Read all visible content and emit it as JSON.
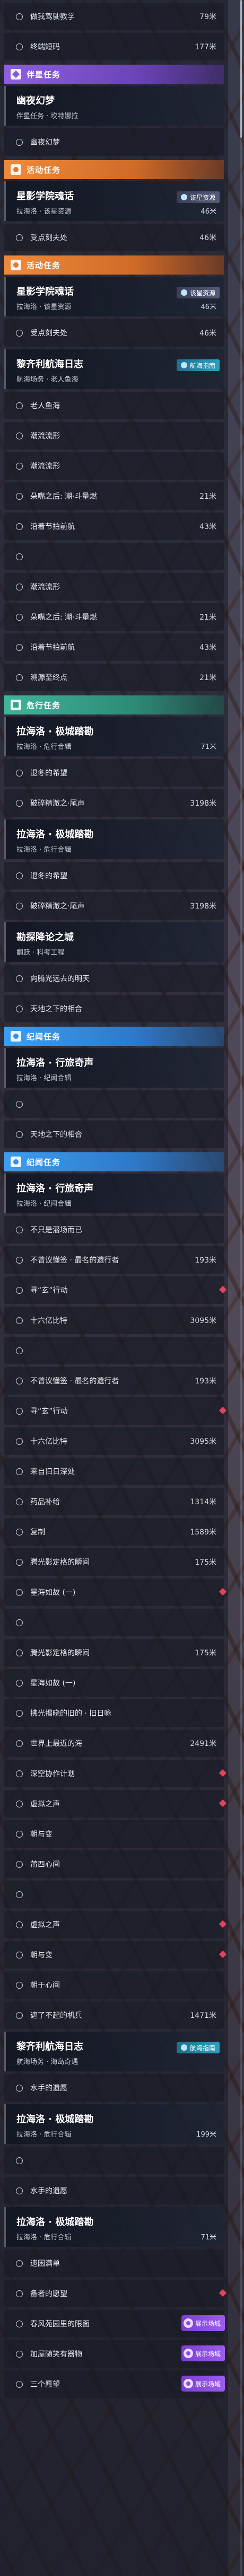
{
  "items": [
    {
      "t": "row",
      "label": "做我驾驶教学",
      "dist": "79米"
    },
    {
      "t": "row",
      "label": "终端短码",
      "dist": "177米"
    },
    {
      "t": "hdr",
      "color": "purple",
      "label": "伴星任务"
    },
    {
      "t": "card",
      "title": "幽夜幻梦",
      "sub": "伴星任务 · 坎特娜拉"
    },
    {
      "t": "row",
      "label": "幽夜幻梦"
    },
    {
      "t": "hdr",
      "color": "orange",
      "label": "活动任务"
    },
    {
      "t": "card",
      "title": "星影学院魂话",
      "sub": "拉海洛 · 该星资源",
      "tag": "该星资源",
      "dist": "46米"
    },
    {
      "t": "row",
      "label": "受点刻夫处",
      "dist": "46米"
    },
    {
      "t": "hdr",
      "color": "orange",
      "label": "活动任务"
    },
    {
      "t": "card",
      "title": "星影学院魂话",
      "sub": "拉海洛 · 该星资源",
      "tag": "该星资源",
      "dist": "46米"
    },
    {
      "t": "row",
      "label": "受点刻夫处",
      "dist": "46米"
    },
    {
      "t": "card",
      "title": "黎齐利航海日志",
      "sub": "航海场务 · 老人鱼海",
      "tag": "航海指南",
      "tag_style": "teal"
    },
    {
      "t": "row",
      "label": "老人鱼海",
      "badge": false
    },
    {
      "t": "row",
      "label": "潮流流形"
    },
    {
      "t": "row",
      "label": "潮流流形"
    },
    {
      "t": "row",
      "label": "朵嘴之后: 潮·斗量燃",
      "dist": "21米"
    },
    {
      "t": "row",
      "label": "沿着节拍前航",
      "dist": "43米"
    },
    {
      "t": "row",
      "label": ""
    },
    {
      "t": "row",
      "label": "潮流流形"
    },
    {
      "t": "row",
      "label": "朵嘴之后: 潮·斗量燃",
      "dist": "21米"
    },
    {
      "t": "row",
      "label": "沿着节拍前航",
      "dist": "43米"
    },
    {
      "t": "row",
      "label": "溯源至终点",
      "dist": "21米"
    },
    {
      "t": "hdr",
      "color": "green",
      "label": "危行任务"
    },
    {
      "t": "card",
      "title": "拉海洛 · 极城踏勘",
      "sub": "拉海洛 · 危行合辑",
      "dist": "71米"
    },
    {
      "t": "row",
      "label": "退冬的希望"
    },
    {
      "t": "row",
      "label": "破碎精澈之·尾声",
      "dist": "3198米"
    },
    {
      "t": "card",
      "title": "拉海洛 · 极城踏勘",
      "sub": "拉海洛 · 危行合辑"
    },
    {
      "t": "row",
      "label": "退冬的希望"
    },
    {
      "t": "row",
      "label": "破碎精澈之·尾声",
      "dist": "3198米"
    },
    {
      "t": "card",
      "title": "勘探降论之城",
      "sub": "翻跃 · 科考工程"
    },
    {
      "t": "row",
      "label": "向腾光远去的明天"
    },
    {
      "t": "row",
      "label": "天地之下的相合"
    },
    {
      "t": "hdr",
      "color": "blue",
      "label": "纪闻任务"
    },
    {
      "t": "card",
      "title": "拉海洛 · 行旅奇声",
      "sub": "拉海洛 · 纪闻合辑"
    },
    {
      "t": "row",
      "label": ""
    },
    {
      "t": "row",
      "label": "天地之下的相合"
    },
    {
      "t": "hdr",
      "color": "blue",
      "label": "纪闻任务"
    },
    {
      "t": "card",
      "title": "拉海洛 · 行旅奇声",
      "sub": "拉海洛 · 纪闻合辑"
    },
    {
      "t": "row",
      "label": "不只是潜场而已"
    },
    {
      "t": "row",
      "label": "不曾议懂签 · 最名的遗行者",
      "dist": "193米"
    },
    {
      "t": "row",
      "label": "寻“玄”行动",
      "diamond": true
    },
    {
      "t": "row",
      "label": "十六亿比特",
      "dist": "3095米"
    },
    {
      "t": "row",
      "label": ""
    },
    {
      "t": "row",
      "label": "不曾议懂签 · 最名的遗行者",
      "dist": "193米"
    },
    {
      "t": "row",
      "label": "寻“玄”行动",
      "diamond": true
    },
    {
      "t": "row",
      "label": "十六亿比特",
      "dist": "3095米"
    },
    {
      "t": "row",
      "label": "来自旧日深处"
    },
    {
      "t": "row",
      "label": "药品补给",
      "dist": "1314米"
    },
    {
      "t": "row",
      "label": "复制",
      "dist": "1589米"
    },
    {
      "t": "row",
      "label": "腾光影定格的瞬间",
      "dist": "175米"
    },
    {
      "t": "row",
      "label": "星海如故 (一)",
      "diamond": true
    },
    {
      "t": "row",
      "label": ""
    },
    {
      "t": "row",
      "label": "腾光影定格的瞬间",
      "dist": "175米"
    },
    {
      "t": "row",
      "label": "星海如故 (一)"
    },
    {
      "t": "row",
      "label": "拂光揭晓的旧的 · 旧日咏"
    },
    {
      "t": "row",
      "label": "世界上最近的海",
      "dist": "2491米"
    },
    {
      "t": "row",
      "label": "深空协作计划",
      "diamond": true
    },
    {
      "t": "row",
      "label": "虚拟之声",
      "diamond": true
    },
    {
      "t": "row",
      "label": "朝与变"
    },
    {
      "t": "row",
      "label": "莆西心间"
    },
    {
      "t": "row",
      "label": ""
    },
    {
      "t": "row",
      "label": "虚拟之声",
      "diamond": true
    },
    {
      "t": "row",
      "label": "朝与变",
      "diamond": true
    },
    {
      "t": "row",
      "label": "朝于心间"
    },
    {
      "t": "row",
      "label": "遮了不起的机兵",
      "dist": "1471米"
    },
    {
      "t": "card",
      "title": "黎齐利航海日志",
      "sub": "航海场务 · 海岛奇遇",
      "tag": "航海指南",
      "tag_style": "teal"
    },
    {
      "t": "row",
      "label": "水手的遗愿"
    },
    {
      "t": "card",
      "title": "拉海洛 · 极城踏勘",
      "sub": "拉海洛 · 危行合辑",
      "dist": "199米"
    },
    {
      "t": "row",
      "label": ""
    },
    {
      "t": "row",
      "label": "水手的遗愿"
    },
    {
      "t": "card",
      "title": "拉海洛 · 极城踏勘",
      "sub": "拉海洛 · 危行合辑",
      "dist": "71米"
    },
    {
      "t": "row",
      "label": "遗困满单"
    },
    {
      "t": "row",
      "label": "备者的愿望",
      "diamond": true
    },
    {
      "t": "row",
      "label": "春风苑园里的限面",
      "dist": "199米",
      "badge": true,
      "badge_text": "展示场域"
    },
    {
      "t": "row",
      "label": "加屋随笑有器物",
      "dist": "199米",
      "badge": true,
      "badge_text": "展示场域"
    },
    {
      "t": "row",
      "label": "三个愿望",
      "badge": true,
      "badge_text": "展示场域"
    }
  ]
}
